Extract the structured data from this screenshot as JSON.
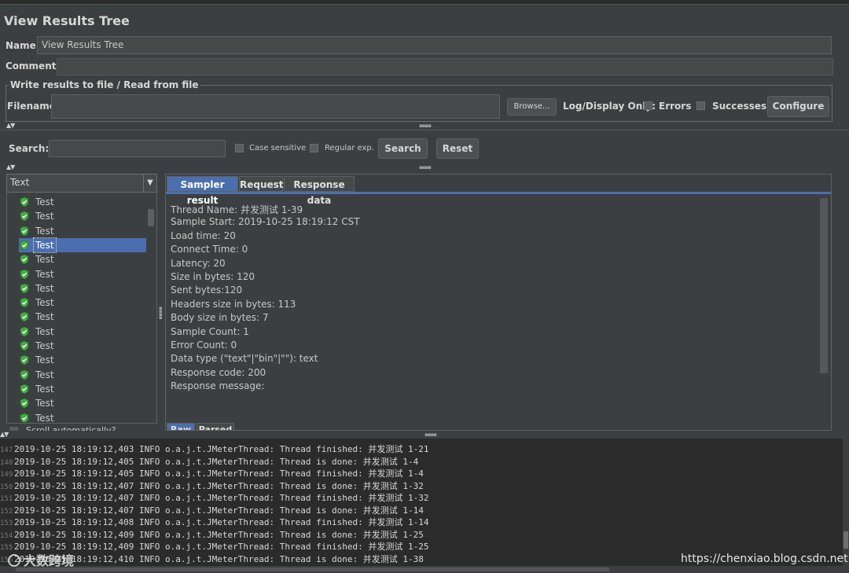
{
  "window": {
    "title": "View Results Tree"
  },
  "name_row": {
    "label": "Name:",
    "value": "View Results Tree"
  },
  "comments_row": {
    "label": "Comments:"
  },
  "file_group": {
    "legend": "Write results to file / Read from file",
    "filename_label": "Filename",
    "filename_value": "",
    "browse_label": "Browse...",
    "log_display_label": "Log/Display Only:",
    "errors_label": "Errors",
    "successes_label": "Successes",
    "configure_label": "Configure"
  },
  "search": {
    "label": "Search:",
    "value": "",
    "case_sensitive_label": "Case sensitive",
    "regular_exp_label": "Regular exp.",
    "search_button": "Search",
    "reset_button": "Reset"
  },
  "renderer_select": {
    "selected": "Text"
  },
  "tree": {
    "items": [
      {
        "label": "Test",
        "status": "success"
      },
      {
        "label": "Test",
        "status": "success"
      },
      {
        "label": "Test",
        "status": "success"
      },
      {
        "label": "Test",
        "status": "success",
        "selected": true
      },
      {
        "label": "Test",
        "status": "success"
      },
      {
        "label": "Test",
        "status": "success"
      },
      {
        "label": "Test",
        "status": "success"
      },
      {
        "label": "Test",
        "status": "success"
      },
      {
        "label": "Test",
        "status": "success"
      },
      {
        "label": "Test",
        "status": "success"
      },
      {
        "label": "Test",
        "status": "success"
      },
      {
        "label": "Test",
        "status": "success"
      },
      {
        "label": "Test",
        "status": "success"
      },
      {
        "label": "Test",
        "status": "success"
      },
      {
        "label": "Test",
        "status": "success"
      },
      {
        "label": "Test",
        "status": "success"
      }
    ],
    "scroll_auto_label": "Scroll automatically?"
  },
  "tabs": [
    {
      "label": "Sampler result",
      "active": true
    },
    {
      "label": "Request",
      "active": false
    },
    {
      "label": "Response data",
      "active": false
    }
  ],
  "sampler_result": [
    "Thread Name: 并发测试 1-39",
    "Sample Start: 2019-10-25 18:19:12 CST",
    "Load time: 20",
    "Connect Time: 0",
    "Latency: 20",
    "Size in bytes: 120",
    "Sent bytes:120",
    "Headers size in bytes: 113",
    "Body size in bytes: 7",
    "Sample Count: 1",
    "Error Count: 0",
    "Data type (\"text\"|\"bin\"|\"\"): text",
    "Response code: 200",
    "Response message:"
  ],
  "bottom_tabs": [
    {
      "label": "Raw",
      "active": true
    },
    {
      "label": "Parsed",
      "active": false
    }
  ],
  "log": {
    "lines": [
      {
        "n": "147",
        "text": "2019-10-25 18:19:12,403 INFO o.a.j.t.JMeterThread: Thread finished: 并发测试 1-21"
      },
      {
        "n": "148",
        "text": "2019-10-25 18:19:12,405 INFO o.a.j.t.JMeterThread: Thread is done: 并发测试 1-4"
      },
      {
        "n": "149",
        "text": "2019-10-25 18:19:12,405 INFO o.a.j.t.JMeterThread: Thread finished: 并发测试 1-4"
      },
      {
        "n": "150",
        "text": "2019-10-25 18:19:12,407 INFO o.a.j.t.JMeterThread: Thread is done: 并发测试 1-32"
      },
      {
        "n": "151",
        "text": "2019-10-25 18:19:12,407 INFO o.a.j.t.JMeterThread: Thread finished: 并发测试 1-32"
      },
      {
        "n": "152",
        "text": "2019-10-25 18:19:12,407 INFO o.a.j.t.JMeterThread: Thread is done: 并发测试 1-14"
      },
      {
        "n": "153",
        "text": "2019-10-25 18:19:12,408 INFO o.a.j.t.JMeterThread: Thread finished: 并发测试 1-14"
      },
      {
        "n": "154",
        "text": "2019-10-25 18:19:12,409 INFO o.a.j.t.JMeterThread: Thread is done: 并发测试 1-25"
      },
      {
        "n": "155",
        "text": "2019-10-25 18:19:12,409 INFO o.a.j.t.JMeterThread: Thread finished: 并发测试 1-25"
      },
      {
        "n": "156",
        "text": "2019-10-25 18:19:12,410 INFO o.a.j.t.JMeterThread: Thread is done: 并发测试 1-38"
      }
    ]
  },
  "watermarks": {
    "left": "大数跨境",
    "right": "https://chenxiao.blog.csdn.net"
  },
  "colors": {
    "background": "#3c3f41",
    "selection": "#4b6eaf",
    "success_icon": "#3fae3f",
    "log_background": "#2b2b2b"
  }
}
